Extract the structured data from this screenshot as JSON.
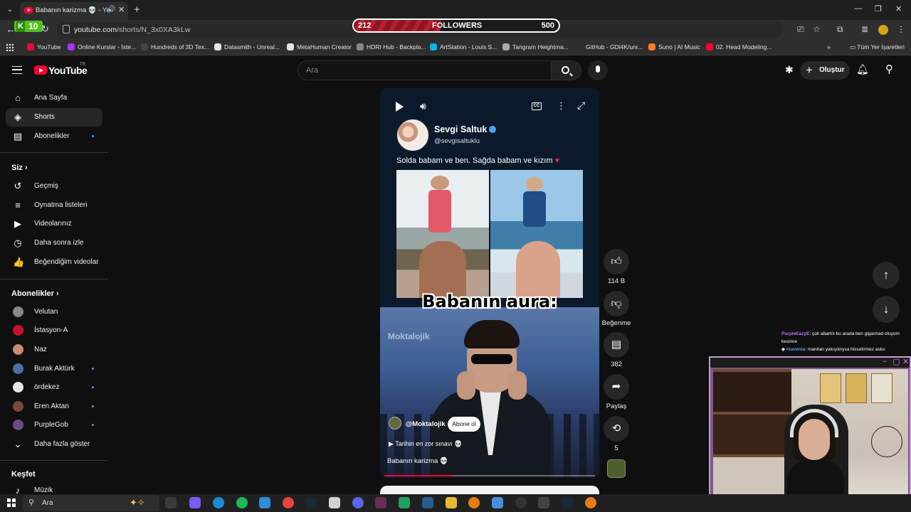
{
  "browser": {
    "tab_title": "Babanın karizma 💀 - YouTube",
    "url_host": "youtube.com",
    "url_path": "/shorts/N_3x0XA3kLw",
    "kick_count": "10",
    "kick_letter": "K"
  },
  "follower_goal": {
    "current": "212",
    "label": "FOLLOWERS",
    "target": "500",
    "progress_fraction": 0.424
  },
  "bookmarks": [
    {
      "label": "YouTube",
      "color": "#ff0033"
    },
    {
      "label": "Online Kurslar - İste...",
      "color": "#a435f0"
    },
    {
      "label": "Hundreds of 3D Tex...",
      "color": "#444444"
    },
    {
      "label": "Datasmith - Unreal...",
      "color": "#e6e6e6"
    },
    {
      "label": "MetaHuman Creator",
      "color": "#e6e6e6"
    },
    {
      "label": "HDRI Hub - Backpla...",
      "color": "#888888"
    },
    {
      "label": "ArtStation - Louis S...",
      "color": "#13aff0"
    },
    {
      "label": "Tangram Heightma...",
      "color": "#aaaaaa"
    },
    {
      "label": "GitHub - GDi4K/unr...",
      "color": "#2e2e2e"
    },
    {
      "label": "Suno | AI Music",
      "color": "#f47c2c"
    },
    {
      "label": "02. Head Modeling...",
      "color": "#ff0033"
    }
  ],
  "bookmarks_all": "Tüm Yer İşaretleri",
  "header": {
    "logo_text": "YouTube",
    "region": "TR",
    "search_placeholder": "Ara",
    "create_label": "Oluştur"
  },
  "sidebar": {
    "main": [
      {
        "label": "Ana Sayfa",
        "icon": "⌂"
      },
      {
        "label": "Shorts",
        "icon": "◈"
      },
      {
        "label": "Abonelikler",
        "icon": "▤"
      }
    ],
    "you_heading": "Siz",
    "you": [
      {
        "label": "Geçmiş",
        "icon": "↺"
      },
      {
        "label": "Oynatma listeleri",
        "icon": "≡"
      },
      {
        "label": "Videolarınız",
        "icon": "▶"
      },
      {
        "label": "Daha sonra izle",
        "icon": "◷"
      },
      {
        "label": "Beğendiğim videolar",
        "icon": "👍"
      }
    ],
    "subs_heading": "Abonelikler",
    "subs": [
      {
        "label": "Velutan",
        "color": "#888888"
      },
      {
        "label": "İstasyon-A",
        "color": "#c8102e"
      },
      {
        "label": "Naz",
        "color": "#c98b72"
      },
      {
        "label": "Burak Aktürk",
        "color": "#4a6fa5"
      },
      {
        "label": "ördekez",
        "color": "#e6e6e6"
      },
      {
        "label": "Eren Aktan",
        "color": "#7a4a3a"
      },
      {
        "label": "PurpleGob",
        "color": "#6a4a8a"
      }
    ],
    "show_more": "Daha fazla göster",
    "explore_heading": "Keşfet",
    "explore": [
      {
        "label": "Müzik",
        "icon": "♪"
      }
    ]
  },
  "short": {
    "author_name": "Sevgi Saltuk",
    "author_handle": "@sevgisaltuklu",
    "caption": "Solda babam ve ben. Sağda babam ve kızım",
    "overlay_title": "Babanın aura:",
    "watermark": "Moktalojik",
    "channel": "@Moktalojik",
    "subscribe_label": "Abone ol",
    "playlist": "Tarihin en zor sınavı 💀",
    "title": "Babanın karizma 💀",
    "progress_fraction": 0.32
  },
  "actions": {
    "likes": "114 B",
    "dislike": "Beğenme",
    "comments": "382",
    "share": "Paylaş",
    "remix": "5"
  },
  "chat": [
    {
      "user": "PurpleEazyE",
      "text": ": çok abartılı bu arada ben gigachad oluyom kesince"
    },
    {
      "user": "niuvenia",
      "text": ": manitan yakışıklıysa hissetirmez asko"
    }
  ],
  "taskbar": {
    "search_placeholder": "Ara"
  }
}
